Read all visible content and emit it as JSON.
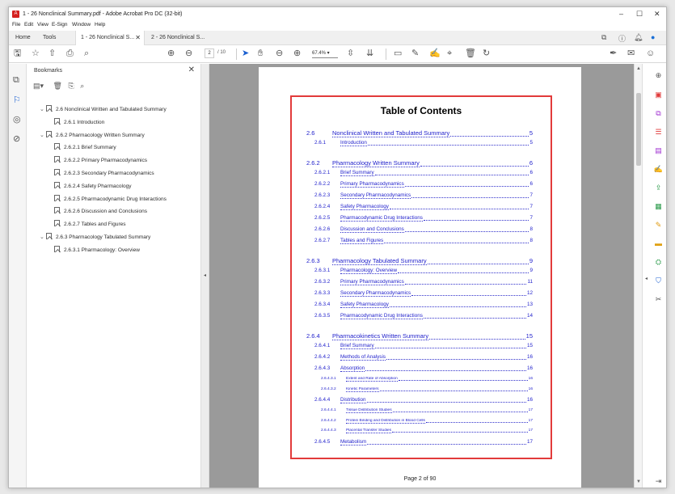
{
  "window": {
    "title": "1 - 26 Nonclinical Summary.pdf - Adobe Acrobat Pro DC (32-bit)",
    "controls": [
      "–",
      "☐",
      "✕"
    ]
  },
  "menu": [
    "File",
    "Edit",
    "View",
    "E-Sign",
    "Window",
    "Help"
  ],
  "tabs": {
    "home": "Home",
    "tools": "Tools",
    "doc1": "1 - 26 Nonclinical S...",
    "doc2": "2 - 26 Nonclinical S...",
    "close": "✕"
  },
  "toolbar": {
    "page_current": "2",
    "page_total": "/ 10",
    "zoom": "67.4%"
  },
  "bookmarks": {
    "title": "Bookmarks",
    "close": "✕",
    "items": [
      {
        "label": "2.6 Nonclinical Written and Tabulated Summary",
        "level": 0,
        "expanded": true
      },
      {
        "label": "2.6.1 Introduction",
        "level": 1,
        "expanded": null
      },
      {
        "label": "2.6.2 Pharmacology Written Summary",
        "level": 0,
        "expanded": true
      },
      {
        "label": "2.6.2.1 Brief Summary",
        "level": 1,
        "expanded": null
      },
      {
        "label": "2.6.2.2 Primary Pharmacodynamics",
        "level": 1,
        "expanded": null
      },
      {
        "label": "2.6.2.3 Secondary Pharmacodynamics",
        "level": 1,
        "expanded": null
      },
      {
        "label": "2.6.2.4 Safety Pharmacology",
        "level": 1,
        "expanded": null
      },
      {
        "label": "2.6.2.5 Pharmacodynamic Drug Interactions",
        "level": 1,
        "expanded": null
      },
      {
        "label": "2.6.2.6 Discussion and Conclusions",
        "level": 1,
        "expanded": null
      },
      {
        "label": "2.6.2.7 Tables and Figures",
        "level": 1,
        "expanded": null
      },
      {
        "label": "2.6.3 Pharmacology Tabulated Summary",
        "level": 0,
        "expanded": true
      },
      {
        "label": "2.6.3.1 Pharmacology: Overview",
        "level": 1,
        "expanded": null
      }
    ]
  },
  "document": {
    "toc_title": "Table of Contents",
    "entries": [
      {
        "num": "2.6",
        "title": "Nonclinical Written and Tabulated Summary",
        "page": "5",
        "level": 1
      },
      {
        "num": "2.6.1",
        "title": "Introduction",
        "page": "5",
        "level": 2
      },
      {
        "num": "2.6.2",
        "title": "Pharmacology Written Summary",
        "page": "6",
        "level": 1
      },
      {
        "num": "2.6.2.1",
        "title": "Brief Summary",
        "page": "6",
        "level": 2
      },
      {
        "num": "2.6.2.2",
        "title": "Primary Pharmacodynamics",
        "page": "6",
        "level": 2
      },
      {
        "num": "2.6.2.3",
        "title": "Secondary Pharmacodynamics",
        "page": "7",
        "level": 2
      },
      {
        "num": "2.6.2.4",
        "title": "Safety Pharmacology",
        "page": "7",
        "level": 2
      },
      {
        "num": "2.6.2.5",
        "title": "Pharmacodynamic Drug Interactions",
        "page": "7",
        "level": 2
      },
      {
        "num": "2.6.2.6",
        "title": "Discussion and Conclusions",
        "page": "8",
        "level": 2
      },
      {
        "num": "2.6.2.7",
        "title": "Tables and Figures",
        "page": "8",
        "level": 2
      },
      {
        "num": "2.6.3",
        "title": "Pharmacology Tabulated Summary",
        "page": "9",
        "level": 1
      },
      {
        "num": "2.6.3.1",
        "title": "Pharmacology:    Overview",
        "page": "9",
        "level": 2
      },
      {
        "num": "2.6.3.2",
        "title": "Primary Pharmacodynamics",
        "page": "11",
        "level": 2
      },
      {
        "num": "2.6.3.3",
        "title": "Secondary Pharmacodynamics",
        "page": "12",
        "level": 2
      },
      {
        "num": "2.6.3.4",
        "title": "Safety Pharmacology",
        "page": "13",
        "level": 2
      },
      {
        "num": "2.6.3.5",
        "title": "Pharmacodynamic Drug Interactions",
        "page": "14",
        "level": 2
      },
      {
        "num": "2.6.4",
        "title": "Pharmacokinetics Written Summary",
        "page": "15",
        "level": 1
      },
      {
        "num": "2.6.4.1",
        "title": "Brief Summary",
        "page": "15",
        "level": 2
      },
      {
        "num": "2.6.4.2",
        "title": "Methods of Analysis",
        "page": "16",
        "level": 2
      },
      {
        "num": "2.6.4.3",
        "title": "Absorption",
        "page": "16",
        "level": 2
      },
      {
        "num": "2.6.4.3.1",
        "title": "Extent and Rate of Absorption",
        "page": "16",
        "level": 3
      },
      {
        "num": "2.6.4.3.2",
        "title": "Kinetic Parameters",
        "page": "16",
        "level": 3
      },
      {
        "num": "2.6.4.4",
        "title": "Distribution",
        "page": "16",
        "level": 2
      },
      {
        "num": "2.6.4.4.1",
        "title": "Tissue Distribution Studies",
        "page": "17",
        "level": 3
      },
      {
        "num": "2.6.4.4.2",
        "title": "Protein Binding and Distribution in Blood Cells",
        "page": "17",
        "level": 3
      },
      {
        "num": "2.6.4.4.3",
        "title": "Placental Transfer Studies",
        "page": "17",
        "level": 3
      },
      {
        "num": "2.6.4.5",
        "title": "Metabolism",
        "page": "17",
        "level": 2
      }
    ],
    "page_label": "Page 2 of 90"
  },
  "colors": {
    "toc_link": "#2222cc",
    "highlight_border": "#e23b3b",
    "acrobat_red": "#d4201e"
  }
}
